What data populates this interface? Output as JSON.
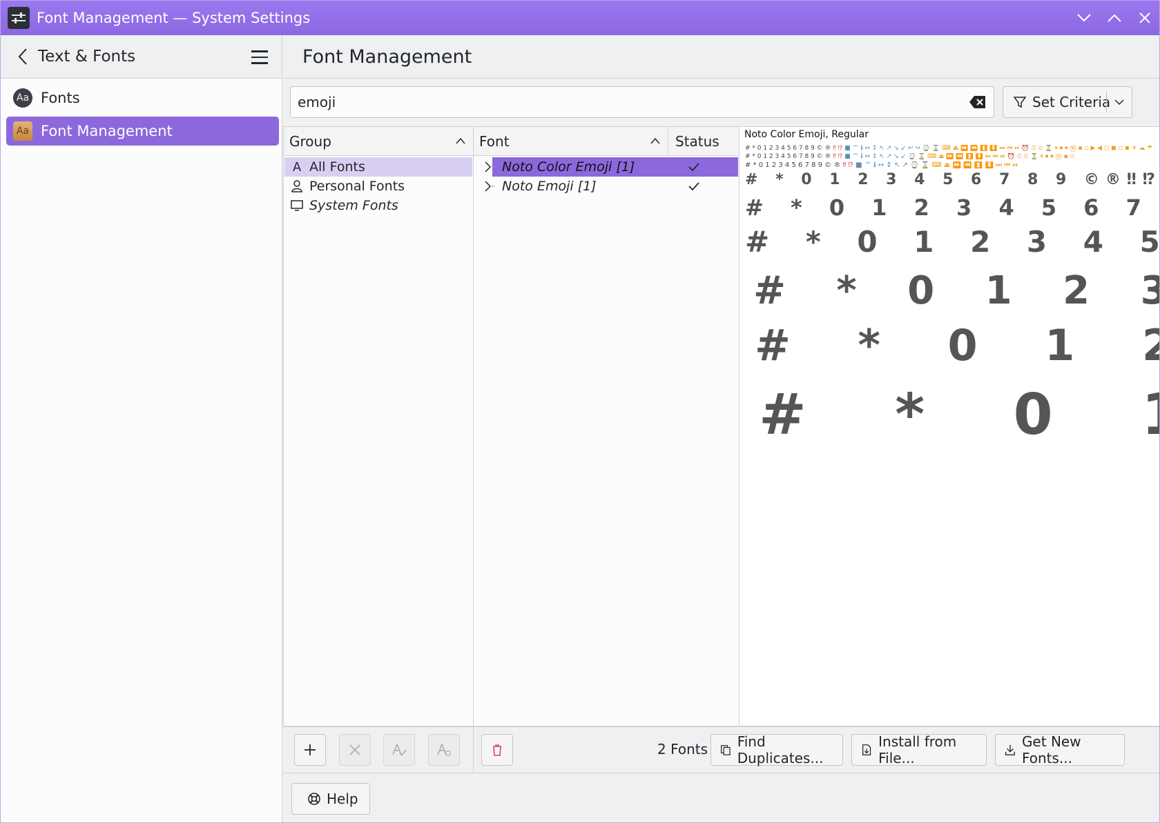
{
  "window": {
    "title": "Font Management — System Settings"
  },
  "sidebar": {
    "header_title": "Text & Fonts",
    "items": [
      {
        "label": "Fonts",
        "icon": "Aa",
        "selected": false
      },
      {
        "label": "Font Management",
        "icon": "Aa",
        "selected": true
      }
    ]
  },
  "main": {
    "title": "Font Management",
    "search": {
      "value": "emoji"
    },
    "criteria_label": "Set Criteria"
  },
  "group_pane": {
    "header": "Group",
    "groups": [
      {
        "label": "All Fonts",
        "selected": true
      },
      {
        "label": "Personal Fonts",
        "selected": false
      },
      {
        "label": "System Fonts",
        "selected": false
      }
    ]
  },
  "font_pane": {
    "headers": {
      "font": "Font",
      "status": "Status"
    },
    "fonts": [
      {
        "name": "Noto Color Emoji [1]",
        "selected": true,
        "enabled": true
      },
      {
        "name": "Noto Emoji [1]",
        "selected": false,
        "enabled": true
      }
    ]
  },
  "preview": {
    "title": "Noto Color Emoji, Regular",
    "lines": [
      "# * 0 1 2 3 4 5 6 7 8 9 ©®‼⁉",
      "# * 0 1 2 3 4 5 6 7 8 9 ©",
      "# * 0 1 2 3 4 5 6 7",
      "# * 0 1 2 3 4",
      "# * 0 1 2 3",
      "# * 0 1 2"
    ]
  },
  "bottom": {
    "count": "2 Fonts",
    "find_duplicates": "Find Duplicates...",
    "install_from_file": "Install from File...",
    "get_new_fonts": "Get New Fonts...",
    "help": "Help"
  },
  "colors": {
    "accent": "#8c68dd",
    "titlebar": "#9370e8",
    "selection_light": "#d9cff3"
  }
}
